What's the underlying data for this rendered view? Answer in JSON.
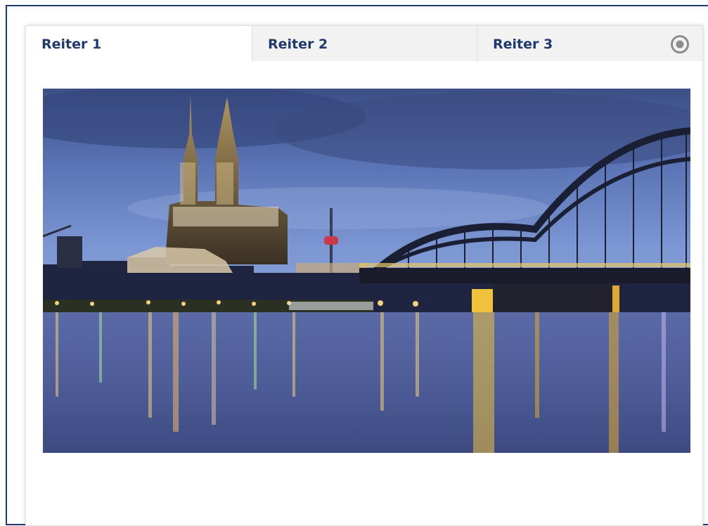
{
  "tabs": [
    {
      "label": "Reiter 1",
      "active": true
    },
    {
      "label": "Reiter 2",
      "active": false
    },
    {
      "label": "Reiter 3",
      "active": false
    }
  ],
  "settings_icon": "record-circle-icon",
  "colors": {
    "frame_border": "#1d3a6b",
    "tab_text": "#1d3a6b",
    "tab_inactive_bg": "#f2f2f2",
    "tab_active_bg": "#ffffff",
    "icon_gray": "#8c8c8c"
  },
  "image": {
    "subject": "night-skyline-photo"
  }
}
